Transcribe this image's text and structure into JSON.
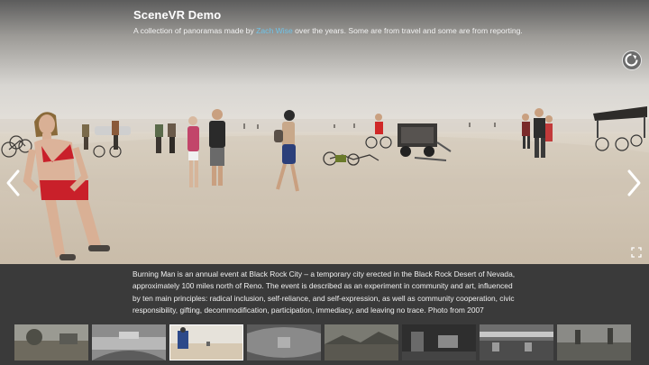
{
  "header": {
    "title": "SceneVR Demo",
    "subtitle_before": "A collection of panoramas made by ",
    "subtitle_link": "Zach Wise",
    "subtitle_after": " over the years. Some are from travel and some are from reporting."
  },
  "controls": {
    "prev_icon": "chevron-left-icon",
    "next_icon": "chevron-right-icon",
    "gyro_icon": "compass-icon",
    "fullscreen_icon": "fullscreen-icon"
  },
  "caption": "Burning Man is an annual event at Black Rock City – a temporary city erected in the Black Rock Desert of Nevada, approximately 100 miles north of Reno. The event is described as an experiment in community and art, influenced by ten main principles: radical inclusion, self-reliance, and self-expression, as well as community cooperation, civic responsibility, gifting, decommodification, participation, immediacy, and leaving no trace. Photo from 2007",
  "thumbnails": {
    "count": 8,
    "active_index": 2
  },
  "colors": {
    "background": "#3a3a3a",
    "link": "#6fc3e8",
    "text": "#f0f0f0"
  }
}
